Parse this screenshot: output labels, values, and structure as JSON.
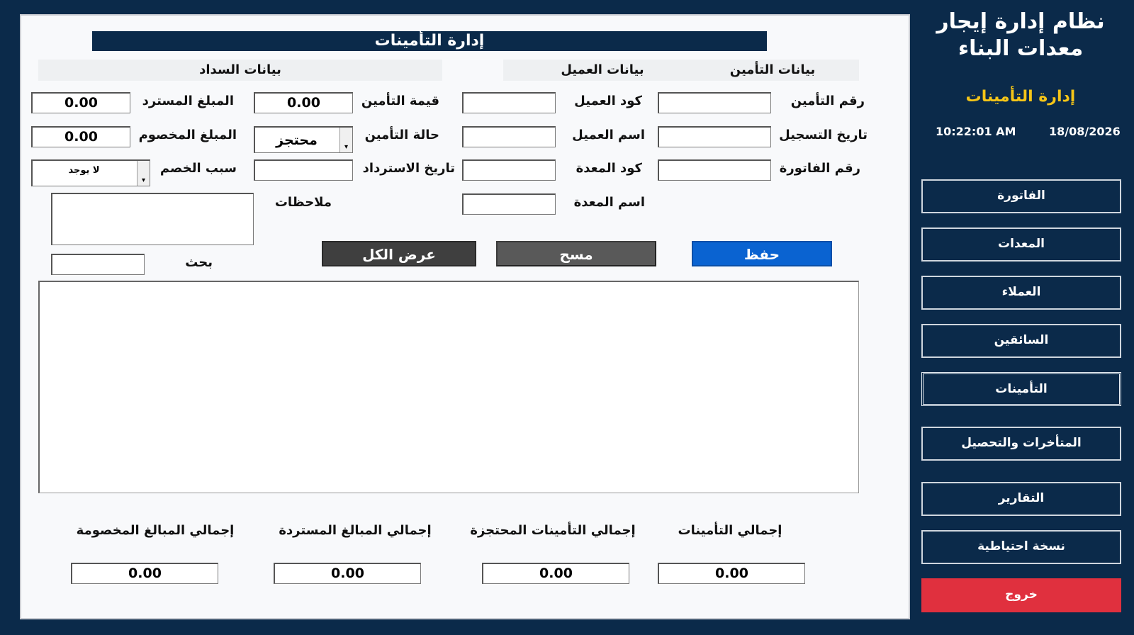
{
  "header": {
    "title": "إدارة التأمينات"
  },
  "sections": {
    "insurance": "بيانات التأمين",
    "client": "بيانات العميل",
    "payment": "بيانات السداد"
  },
  "insurance": {
    "number_label": "رقم التأمين",
    "number_value": "",
    "reg_date_label": "تاريخ التسجيل",
    "reg_date_value": "",
    "invoice_label": "رقم الفاتورة",
    "invoice_value": ""
  },
  "client": {
    "code_label": "كود العميل",
    "code_value": "",
    "name_label": "اسم العميل",
    "name_value": "",
    "equip_code_label": "كود المعدة",
    "equip_code_value": "",
    "equip_name_label": "اسم المعدة",
    "equip_name_value": ""
  },
  "payment": {
    "ins_value_label": "قيمة التأمين",
    "ins_value": "0.00",
    "status_label": "حالة التأمين",
    "status_value": "محتجز",
    "refund_date_label": "تاريخ الاسترداد",
    "refund_date_value": "",
    "refunded_label": "المبلغ المسترد",
    "refunded_value": "0.00",
    "deducted_label": "المبلغ المخصوم",
    "deducted_value": "0.00",
    "reason_label": "سبب الخصم",
    "reason_value": "لا يوجد",
    "notes_label": "ملاحظات",
    "notes_value": ""
  },
  "search": {
    "label": "بحث",
    "value": ""
  },
  "buttons": {
    "save": "حفظ",
    "clear": "مسح",
    "show_all": "عرض الكل"
  },
  "totals": {
    "insurances_label": "إجمالي التأمينات",
    "insurances_value": "0.00",
    "held_label": "إجمالي التأمينات المحتجزة",
    "held_value": "0.00",
    "refunded_label": "إجمالي المبالغ المستردة",
    "refunded_value": "0.00",
    "deducted_label": "إجمالي المبالغ المخصومة",
    "deducted_value": "0.00"
  },
  "sidebar": {
    "title_line1": "نظام إدارة إيجار",
    "title_line2": "معدات البناء",
    "subtitle": "إدارة التأمينات",
    "date": "18/08/2026",
    "time": "10:22:01 AM",
    "nav": [
      "الفاتورة",
      "المعدات",
      "العملاء",
      "السائقين",
      "التأمينات",
      "المتأخرات والتحصيل",
      "التقارير",
      "نسخة احتياطية",
      "خروج"
    ]
  },
  "colors": {
    "navy": "#0b2a4a",
    "accent_yellow": "#f5c518",
    "save_blue": "#0a63d1",
    "exit_red": "#e0303e"
  }
}
